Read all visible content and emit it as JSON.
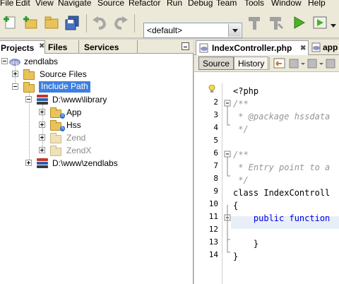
{
  "menubar": {
    "items": [
      "File",
      "Edit",
      "View",
      "Navigate",
      "Source",
      "Refactor",
      "Run",
      "Debug",
      "Team",
      "Tools",
      "Window",
      "Help"
    ]
  },
  "toolbar": {
    "config_value": "<default>"
  },
  "projects_panel": {
    "tabs": [
      "Projects",
      "Files",
      "Services"
    ],
    "tree": {
      "project": "zendlabs",
      "source_files": "Source Files",
      "include_path": "Include Path",
      "library_path": "D:\\www\\library",
      "library_children": [
        "App",
        "Hss",
        "Zend",
        "ZendX"
      ],
      "project_path": "D:\\www\\zendlabs"
    }
  },
  "editor": {
    "tabs": [
      "IndexController.php",
      "app"
    ],
    "views": [
      "Source",
      "History"
    ],
    "line_numbers": [
      "1",
      "2",
      "3",
      "4",
      "5",
      "6",
      "7",
      "8",
      "9",
      "10",
      "11",
      "12",
      "13",
      "14"
    ],
    "lines": [
      "<?php",
      "/**",
      " * @package hssdata",
      " */",
      "",
      "/**",
      " * Entry point to a",
      " */",
      "class IndexControll",
      "{",
      "    public function",
      "",
      "    }",
      "}"
    ]
  },
  "colors": {
    "selection": "#3d80df",
    "keyword": "#0000e6",
    "comment": "#969696"
  }
}
